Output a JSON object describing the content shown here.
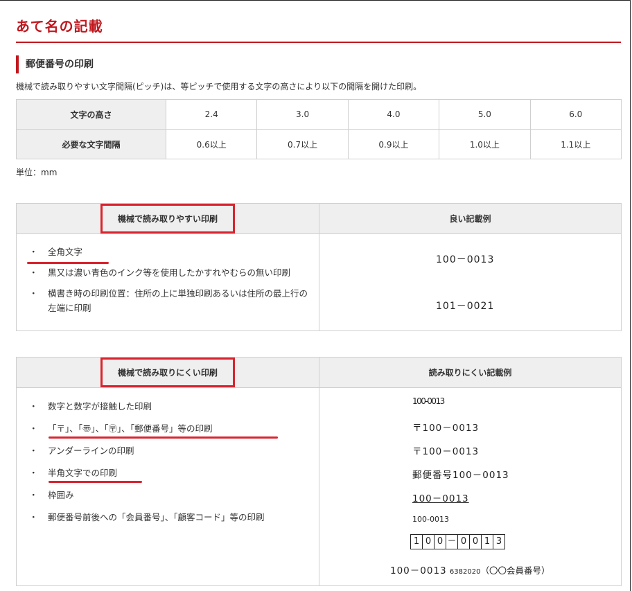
{
  "page": {
    "title": "あて名の記載",
    "section_title": "郵便番号の印刷",
    "description": "機械で読み取りやすい文字間隔(ピッチ)は、等ピッチで使用する文字の高さにより以下の間隔を開けた印刷。",
    "unit_note": "単位：mm"
  },
  "pitch_table": {
    "row1_header": "文字の高さ",
    "row1_values": [
      "2.4",
      "3.0",
      "4.0",
      "5.0",
      "6.0"
    ],
    "row2_header": "必要な文字間隔",
    "row2_values": [
      "0.6以上",
      "0.7以上",
      "0.9以上",
      "1.0以上",
      "1.1以上"
    ]
  },
  "readable": {
    "left_header": "機械で読み取りやすい印刷",
    "right_header": "良い記載例",
    "items": [
      "全角文字",
      "黒又は濃い青色のインク等を使用したかすれやむらの無い印刷",
      "横書き時の印刷位置：住所の上に単独印刷あるいは住所の最上行の左端に印刷"
    ],
    "examples": [
      "100－0013",
      "101－0021"
    ]
  },
  "unreadable": {
    "left_header": "機械で読み取りにくい印刷",
    "right_header": "読み取りにくい記載例",
    "items": [
      "数字と数字が接触した印刷",
      "「〒」、「〠」、「〶」、「郵便番号」等の印刷",
      "アンダーラインの印刷",
      "半角文字での印刷",
      "枠囲み",
      "郵便番号前後への「会員番号」、「顧客コード」等の印刷"
    ],
    "examples": {
      "touching": "100-0013",
      "with_mark": "〒100－0013",
      "with_circle_mark": "〒100－0013",
      "with_label": "郵便番号100－0013",
      "underlined": "100－0013",
      "halfwidth": "100-0013",
      "boxed_chars": [
        "1",
        "0",
        "0",
        "－",
        "0",
        "0",
        "1",
        "3"
      ],
      "member_main": "100－0013",
      "member_code": "6382020",
      "member_suffix": "（〇〇会員番号）"
    }
  }
}
